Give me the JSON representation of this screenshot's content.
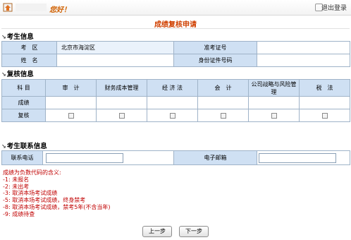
{
  "topbar": {
    "greeting": "您好！",
    "logout_label": "退出登录"
  },
  "page_title": "成绩复核申请",
  "sections": {
    "candidate_info": "考生信息",
    "review_info": "复核信息",
    "contact_info": "考生联系信息"
  },
  "candidate": {
    "region_label": "考　区",
    "region_value": "北京市海淀区",
    "name_label": "姓　名",
    "name_value": "",
    "admission_label": "准考证号",
    "admission_value": "",
    "id_label": "身份证件号码",
    "id_value": ""
  },
  "review": {
    "subject_header": "科 目",
    "subjects": [
      "审　计",
      "财务成本管理",
      "经 济 法",
      "会　计",
      "公司战略与风险管理",
      "税　法"
    ],
    "score_label": "成绩",
    "scores": [
      "",
      "",
      "",
      "",
      "",
      ""
    ],
    "recheck_label": "复核",
    "recheck_checked": [
      false,
      false,
      false,
      false,
      false,
      false
    ]
  },
  "contact": {
    "phone_label": "联系电话",
    "phone_value": "",
    "email_label": "电子邮箱",
    "email_value": ""
  },
  "legend": {
    "title": "成绩为负数代码的含义:",
    "items": [
      "-1: 未报名",
      "-2: 未出考",
      "-3: 取消本场考试成绩",
      "-5: 取消本场考试成绩，终身禁考",
      "-8: 取消本场考试成绩，禁考5年(不含当年)",
      "-9: 成绩待查"
    ]
  },
  "buttons": {
    "prev": "上一步",
    "next": "下一步"
  },
  "colors": {
    "title_orange": "#d04000",
    "label_blue": "#cfe0f3",
    "legend_red": "#c00000"
  }
}
